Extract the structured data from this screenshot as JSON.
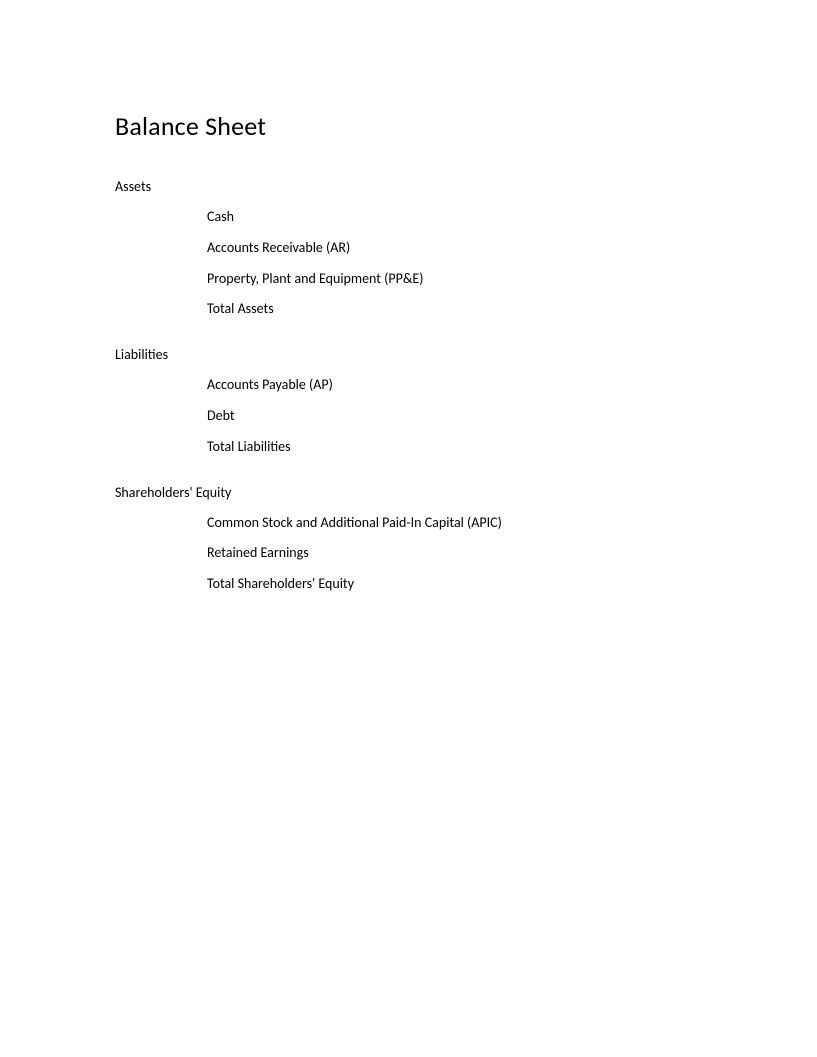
{
  "title": "Balance Sheet",
  "sections": [
    {
      "heading": "Assets",
      "items": [
        "Cash",
        "Accounts Receivable (AR)",
        "Property, Plant and Equipment (PP&E)",
        "Total Assets"
      ]
    },
    {
      "heading": "Liabilities",
      "items": [
        "Accounts Payable (AP)",
        "Debt",
        "Total Liabilities"
      ]
    },
    {
      "heading": "Shareholders' Equity",
      "items": [
        "Common Stock and Additional Paid-In Capital (APIC)",
        "Retained Earnings",
        "Total Shareholders' Equity"
      ]
    }
  ]
}
